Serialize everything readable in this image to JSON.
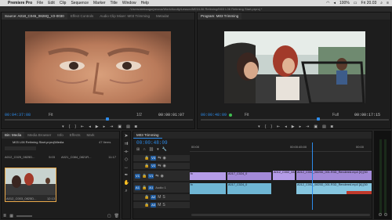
{
  "menubar": {
    "apple": "",
    "app_name": "Premiere Pro",
    "items": [
      "File",
      "Edit",
      "Clip",
      "Sequence",
      "Marker",
      "Title",
      "Window",
      "Help"
    ],
    "battery": "100%",
    "clock": "Fri 20.03",
    "status_icons": [
      "wifi-icon",
      "volume-icon",
      "battery-icon",
      "search-icon",
      "menu-icon"
    ]
  },
  "pathbar": {
    "text": "/Users/aleksagorjanova/Work/Acuity/Lesson/M03/L06 Retiming/M03 L06 Retiming Start.prproj *"
  },
  "source": {
    "tabs": [
      "Source: A018_C045_0828Q_V2-0030",
      "Effect Controls",
      "Audio Clip Mixer: M03 Trimming",
      "Metadat"
    ],
    "timecode_in": "00:04:37:08",
    "fit": "Fit",
    "fraction": "1/2",
    "duration": "00:00:01:07"
  },
  "program": {
    "tabs": [
      "Program: M03 Trimming"
    ],
    "timecode_in": "00:00:48:09",
    "fit": "Fit",
    "quality": "Full",
    "duration": "00:00:17:15"
  },
  "project": {
    "tabs": [
      "Bin: Media",
      "Media Browser",
      "Info",
      "Effects",
      "Mark"
    ],
    "path": "M03 L06 Retiming Start.prproj\\Media",
    "items_count": "47 Items",
    "thumbs": [
      {
        "name": "A012_C025_0825D...",
        "dur": "5:03"
      },
      {
        "name": "A021_C084_0821R...",
        "dur": "11:17"
      },
      {
        "name": "A012_C003_0825D...",
        "dur": "12:13"
      }
    ]
  },
  "timeline": {
    "tabs": [
      "M03 Trimming"
    ],
    "timecode": "00:00:48:09",
    "ruler": [
      "00:00",
      "00:00:45:00",
      "00:00"
    ],
    "tracks": [
      {
        "name": "V3",
        "target": ""
      },
      {
        "name": "V2",
        "target": ""
      },
      {
        "name": "V1",
        "target": "V1"
      },
      {
        "name": "A1",
        "target": "A1",
        "label": "Audio 1"
      },
      {
        "name": "A2",
        "target": ""
      },
      {
        "name": "A3",
        "target": ""
      }
    ],
    "clips": {
      "v1_a": "fx",
      "v1_b": "A017_C024_0",
      "v1_c": "A012_C002_0825D...",
      "v1_d": "A012_C002_0825D_001.R3D_Rendered.mp4 [V] [50",
      "a1_a": "fx",
      "a1_b": "A017_C024_0",
      "a1_c": "A012_C002_0825D_001.R3D_Rendered.mp4 [A] [50"
    }
  },
  "colors": {
    "accent": "#2d8ceb",
    "video_clip": "#b59ce8",
    "audio_clip": "#6fb6d4",
    "marker_green": "#3fbf4f"
  }
}
